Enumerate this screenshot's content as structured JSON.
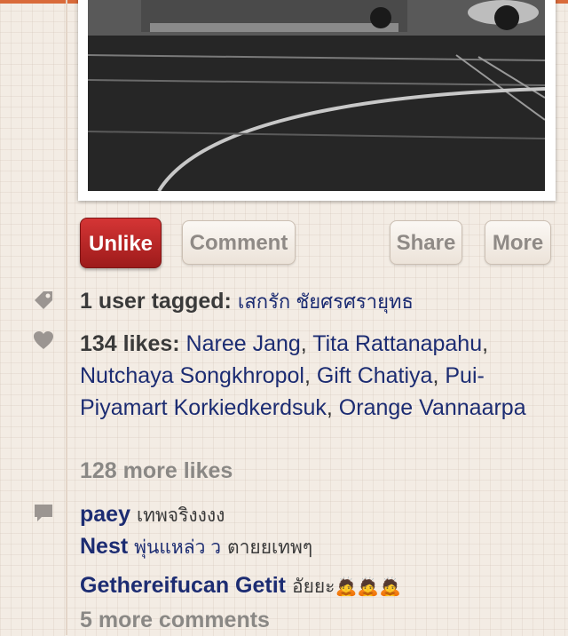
{
  "actions": {
    "unlike": "Unlike",
    "comment": "Comment",
    "share": "Share",
    "more": "More"
  },
  "tags": {
    "label": "1 user tagged:",
    "user": "เสกรัก ชัยศรศรายุทธ"
  },
  "likes": {
    "label": "134 likes:",
    "names": [
      "Naree Jang",
      "Tita Rattanapahu",
      "Nutchaya Songkhropol",
      "Gift Chatiya",
      "Pui-Piyamart Korkiedkerdsuk",
      "Orange Vannaarpa"
    ],
    "more": "128 more likes"
  },
  "comments": {
    "items": [
      {
        "user": "paey",
        "text": "เทพจริงงงง",
        "highlight": ""
      },
      {
        "user": "Nest",
        "highlight": "พุ่นแหล่ว ว",
        "text": "ตายยเทพๆ"
      },
      {
        "user": "Gethereifucan Getit",
        "text": "อัยยะ",
        "highlight": "",
        "emoji": "🙇🙇🙇"
      }
    ],
    "more": "5 more comments"
  },
  "icons": {
    "tag": "tag-icon",
    "like": "heart-icon",
    "comment": "comment-bubble-icon"
  },
  "colors": {
    "accent": "#b72525",
    "link": "#1c2c72",
    "background": "#f3ece4"
  }
}
